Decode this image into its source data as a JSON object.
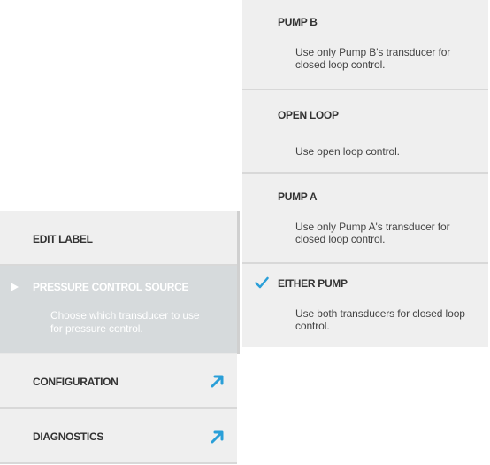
{
  "menu": {
    "items": [
      {
        "label": "EDIT LABEL"
      },
      {
        "label": "PRESSURE CONTROL SOURCE",
        "description": "Choose which transducer to use for pressure control."
      },
      {
        "label": "CONFIGURATION",
        "icon": "launch-icon"
      },
      {
        "label": "DIAGNOSTICS",
        "icon": "launch-icon"
      }
    ]
  },
  "pressure_source": {
    "selected": "EITHER PUMP",
    "options": [
      {
        "label": "PUMP B",
        "description": "Use only Pump B's transducer for closed loop control."
      },
      {
        "label": "OPEN LOOP",
        "description": "Use open loop control."
      },
      {
        "label": "PUMP A",
        "description": "Use only Pump A's transducer for closed loop control."
      },
      {
        "label": "EITHER PUMP",
        "description": "Use both transducers for closed loop control."
      }
    ]
  },
  "colors": {
    "accent": "#2a9fd8",
    "item_bg": "#efefef",
    "selected_bg": "#d6dadc"
  }
}
